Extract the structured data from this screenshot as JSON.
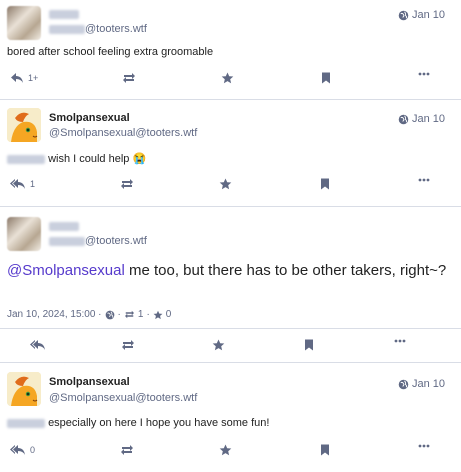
{
  "posts": [
    {
      "handle_suffix": "@tooters.wtf",
      "time": "Jan 10",
      "content": "bored after school feeling extra groomable",
      "reply_count": "1+"
    },
    {
      "name": "Smolpansexual",
      "handle": "@Smolpansexual@tooters.wtf",
      "time": "Jan 10",
      "content": "wish I could help 😭",
      "reply_count": "1"
    },
    {
      "handle_suffix": "@tooters.wtf",
      "mention": "@Smolpansexual",
      "content": " me too, but there has to be other takers, right~?",
      "timestamp": "Jan 10, 2024, 15:00 ·",
      "dot": "·",
      "boost_count": "1",
      "fav_count": "0"
    },
    {
      "name": "Smolpansexual",
      "handle": "@Smolpansexual@tooters.wtf",
      "time": "Jan 10",
      "content": "especially on here I hope you have some fun!",
      "reply_count": "0"
    }
  ],
  "icons": [
    "reply-icon",
    "boost-icon",
    "star-icon",
    "bookmark-icon",
    "more-icon",
    "globe-icon"
  ],
  "colors": {
    "accent": "#563acc",
    "icon": "#606984",
    "separator": "#d9dde6"
  }
}
